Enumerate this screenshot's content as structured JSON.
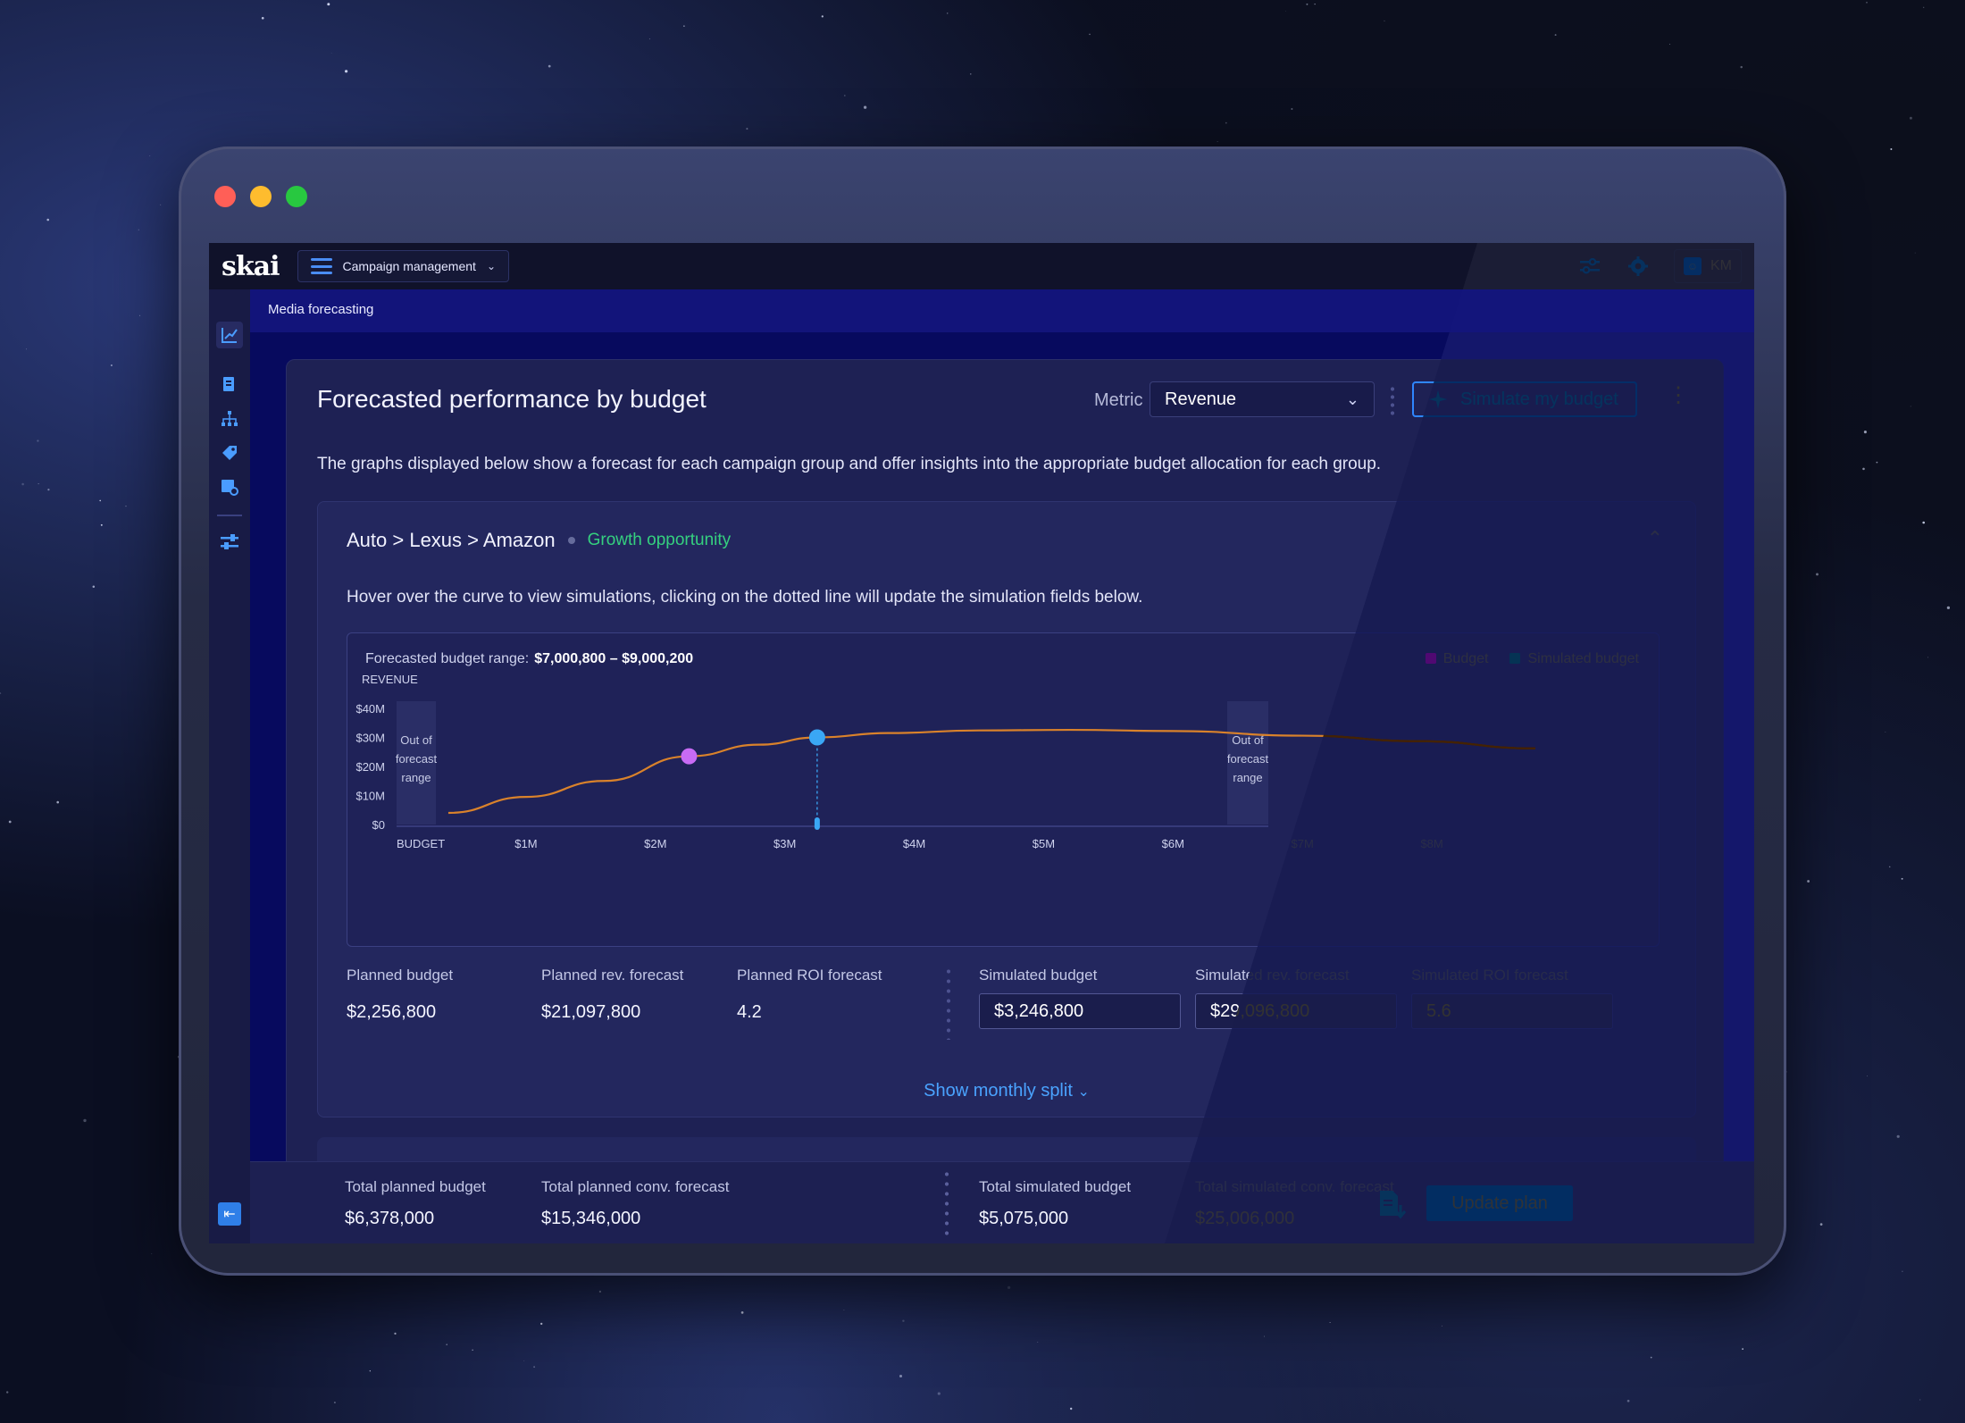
{
  "app": {
    "logo": "skai",
    "menu_label": "Campaign management",
    "user_initials": "KM"
  },
  "breadcrumb": "Media forecasting",
  "card": {
    "title": "Forecasted performance by budget",
    "metric_label": "Metric",
    "metric_value": "Revenue",
    "simulate_label": "Simulate my budget",
    "description": "The graphs displayed below show a forecast for each campaign group and offer insights into the appropriate budget allocation for each group."
  },
  "group": {
    "title": "Auto > Lexus > Amazon",
    "badge": "Growth opportunity",
    "hint": "Hover over the curve to view simulations, clicking on the dotted line will update the simulation fields below."
  },
  "colors": {
    "budget": "#c86bf5",
    "simulated": "#3aa7f5",
    "curve": "#d9822b",
    "growth": "#35d07f"
  },
  "chart_data": {
    "type": "line",
    "range_label": "Forecasted budget range:",
    "range_value": "$7,000,800 – $9,000,200",
    "ylabel": "REVENUE",
    "xlabel": "BUDGET",
    "y_ticks": [
      "$40M",
      "$30M",
      "$20M",
      "$10M",
      "$0"
    ],
    "x_ticks": [
      "$1M",
      "$2M",
      "$3M",
      "$4M",
      "$5M",
      "$6M",
      "$7M",
      "$8M"
    ],
    "out_of_range_label": [
      "Out of",
      "forecast",
      "range"
    ],
    "legend": [
      {
        "name": "Budget",
        "color": "#c86bf5"
      },
      {
        "name": "Simulated budget",
        "color": "#3aa7f5"
      }
    ],
    "series": [
      {
        "x": [
          0.4,
          1.0,
          1.6,
          2.26,
          2.8,
          3.25,
          3.8,
          4.5,
          5.2,
          6.0,
          7.0,
          7.9,
          8.8
        ],
        "y": [
          4,
          9.5,
          15,
          23.5,
          27.5,
          30,
          31.5,
          32.4,
          32.6,
          32.2,
          30.6,
          28.7,
          26.2
        ]
      }
    ],
    "budget_point": {
      "x": 2.26,
      "y": 23.5
    },
    "simulated_point": {
      "x": 3.25,
      "y": 30
    }
  },
  "stats": {
    "planned_budget_label": "Planned budget",
    "planned_budget": "$2,256,800",
    "planned_rev_label": "Planned rev. forecast",
    "planned_rev": "$21,097,800",
    "planned_roi_label": "Planned ROI forecast",
    "planned_roi": "4.2",
    "sim_budget_label": "Simulated budget",
    "sim_budget": "$3,246,800",
    "sim_rev_label": "Simulated rev. forecast",
    "sim_rev": "$29,096,800",
    "sim_roi_label": "Simulated ROI forecast",
    "sim_roi": "5.6"
  },
  "monthly_split": "Show monthly split",
  "footer": {
    "total_planned_budget_label": "Total planned budget",
    "total_planned_budget": "$6,378,000",
    "total_planned_conv_label": "Total planned conv. forecast",
    "total_planned_conv": "$15,346,000",
    "total_sim_budget_label": "Total simulated budget",
    "total_sim_budget": "$5,075,000",
    "total_sim_conv_label": "Total simulated conv. forecast",
    "total_sim_conv": "$25,006,000",
    "update_label": "Update plan"
  }
}
